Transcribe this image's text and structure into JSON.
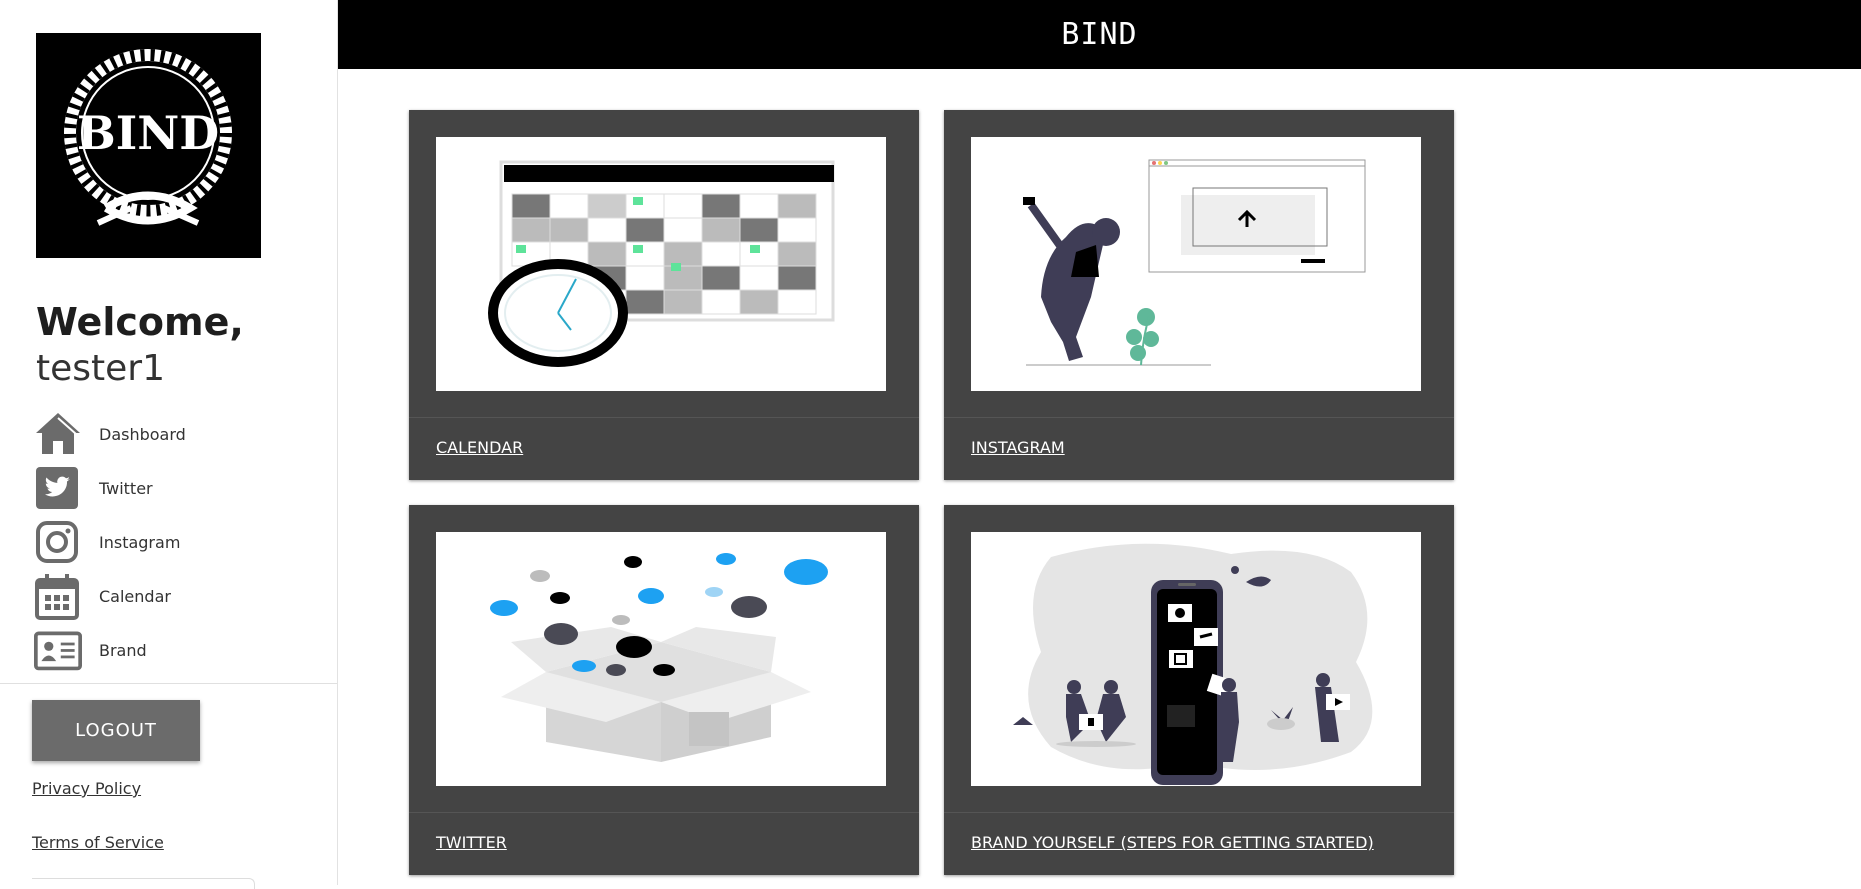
{
  "header": {
    "title": "BIND"
  },
  "logo": {
    "text": "BIND"
  },
  "sidebar": {
    "welcome": "Welcome,",
    "username": "tester1",
    "items": [
      {
        "label": "Dashboard",
        "icon": "home-icon"
      },
      {
        "label": "Twitter",
        "icon": "twitter-icon"
      },
      {
        "label": "Instagram",
        "icon": "instagram-icon"
      },
      {
        "label": "Calendar",
        "icon": "calendar-icon"
      },
      {
        "label": "Brand",
        "icon": "id-card-icon"
      }
    ],
    "logout_label": "LOGOUT",
    "privacy_label": "Privacy Policy",
    "terms_label": "Terms of Service"
  },
  "cards": [
    {
      "label": "CALENDAR",
      "image": "calendar-illustration"
    },
    {
      "label": "INSTAGRAM",
      "image": "instagram-upload-illustration"
    },
    {
      "label": "TWITTER",
      "image": "twitter-birds-box-illustration"
    },
    {
      "label": "BRAND YOURSELF (STEPS FOR GETTING STARTED)",
      "image": "brand-phone-illustration"
    }
  ],
  "colors": {
    "header_bg": "#000000",
    "card_bg": "#444444",
    "icon_gray": "#6b6b6b",
    "logout_bg": "#6b6b6b",
    "accent_green": "#5ee39a",
    "twitter_blue": "#1da1f2"
  }
}
